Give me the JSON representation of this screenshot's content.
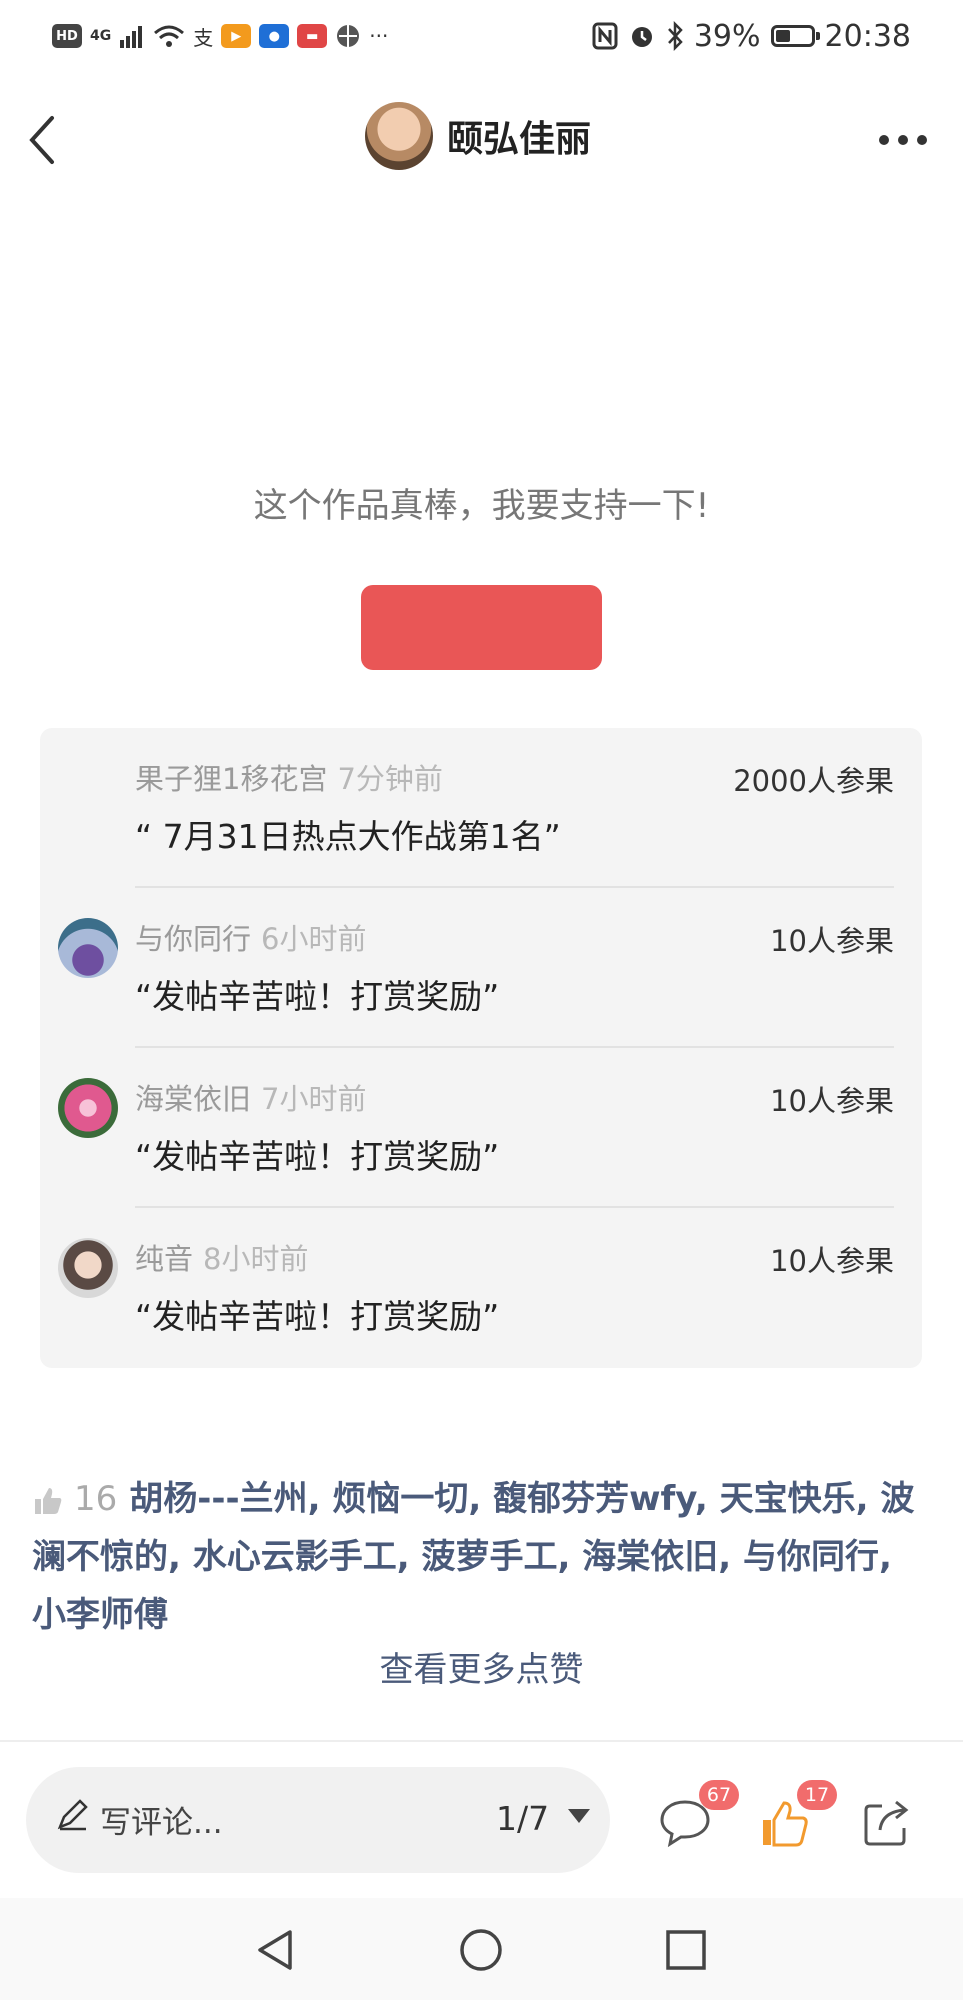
{
  "status_bar": {
    "left_chips": [
      "HD",
      "4G"
    ],
    "battery": "39%",
    "time": "20:38",
    "more": "···"
  },
  "header": {
    "author_name": "颐弘佳丽"
  },
  "support": {
    "prompt": "这个作品真棒，我要支持一下!",
    "button_color": "#e95656"
  },
  "rewards": [
    {
      "name": "果子狸1移花宫",
      "time": "7分钟前",
      "amount": "2000人参果",
      "message": "“ 7月31日热点大作战第1名”",
      "has_avatar": false
    },
    {
      "name": "与你同行",
      "time": "6小时前",
      "amount": "10人参果",
      "message": "“发帖辛苦啦！打赏奖励”",
      "has_avatar": true
    },
    {
      "name": "海棠依旧",
      "time": "7小时前",
      "amount": "10人参果",
      "message": "“发帖辛苦啦！打赏奖励”",
      "has_avatar": true
    },
    {
      "name": "纯音",
      "time": "8小时前",
      "amount": "10人参果",
      "message": "“发帖辛苦啦！打赏奖励”",
      "has_avatar": true
    }
  ],
  "likes": {
    "count": "16",
    "names": "胡杨---兰州, 烦恼一切, 馥郁芬芳wfy, 天宝快乐, 波澜不惊的, 水心云影手工, 菠萝手工, 海棠依旧, 与你同行, 小李师傅",
    "more": "查看更多点赞"
  },
  "bottom_bar": {
    "comment_placeholder": "写评论...",
    "page": "1/7",
    "comment_count": "67",
    "like_count": "17"
  },
  "colors": {
    "accent_red": "#e95656",
    "link_blue": "#4a5a7a",
    "like_orange": "#f29a2e"
  }
}
